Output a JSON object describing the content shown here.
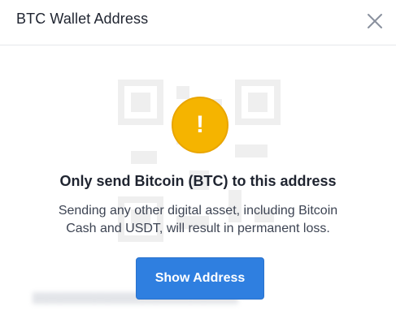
{
  "modal": {
    "title": "BTC Wallet Address",
    "close_icon": "close-icon"
  },
  "warning": {
    "icon": "exclamation-icon",
    "icon_glyph": "!",
    "icon_color": "#f5b400",
    "title": "Only send Bitcoin (BTC) to this address",
    "message": "Sending any other digital asset, including Bitcoin Cash and USDT, will result in permanent loss."
  },
  "actions": {
    "show_address_label": "Show Address",
    "button_color": "#2f7fe0"
  }
}
